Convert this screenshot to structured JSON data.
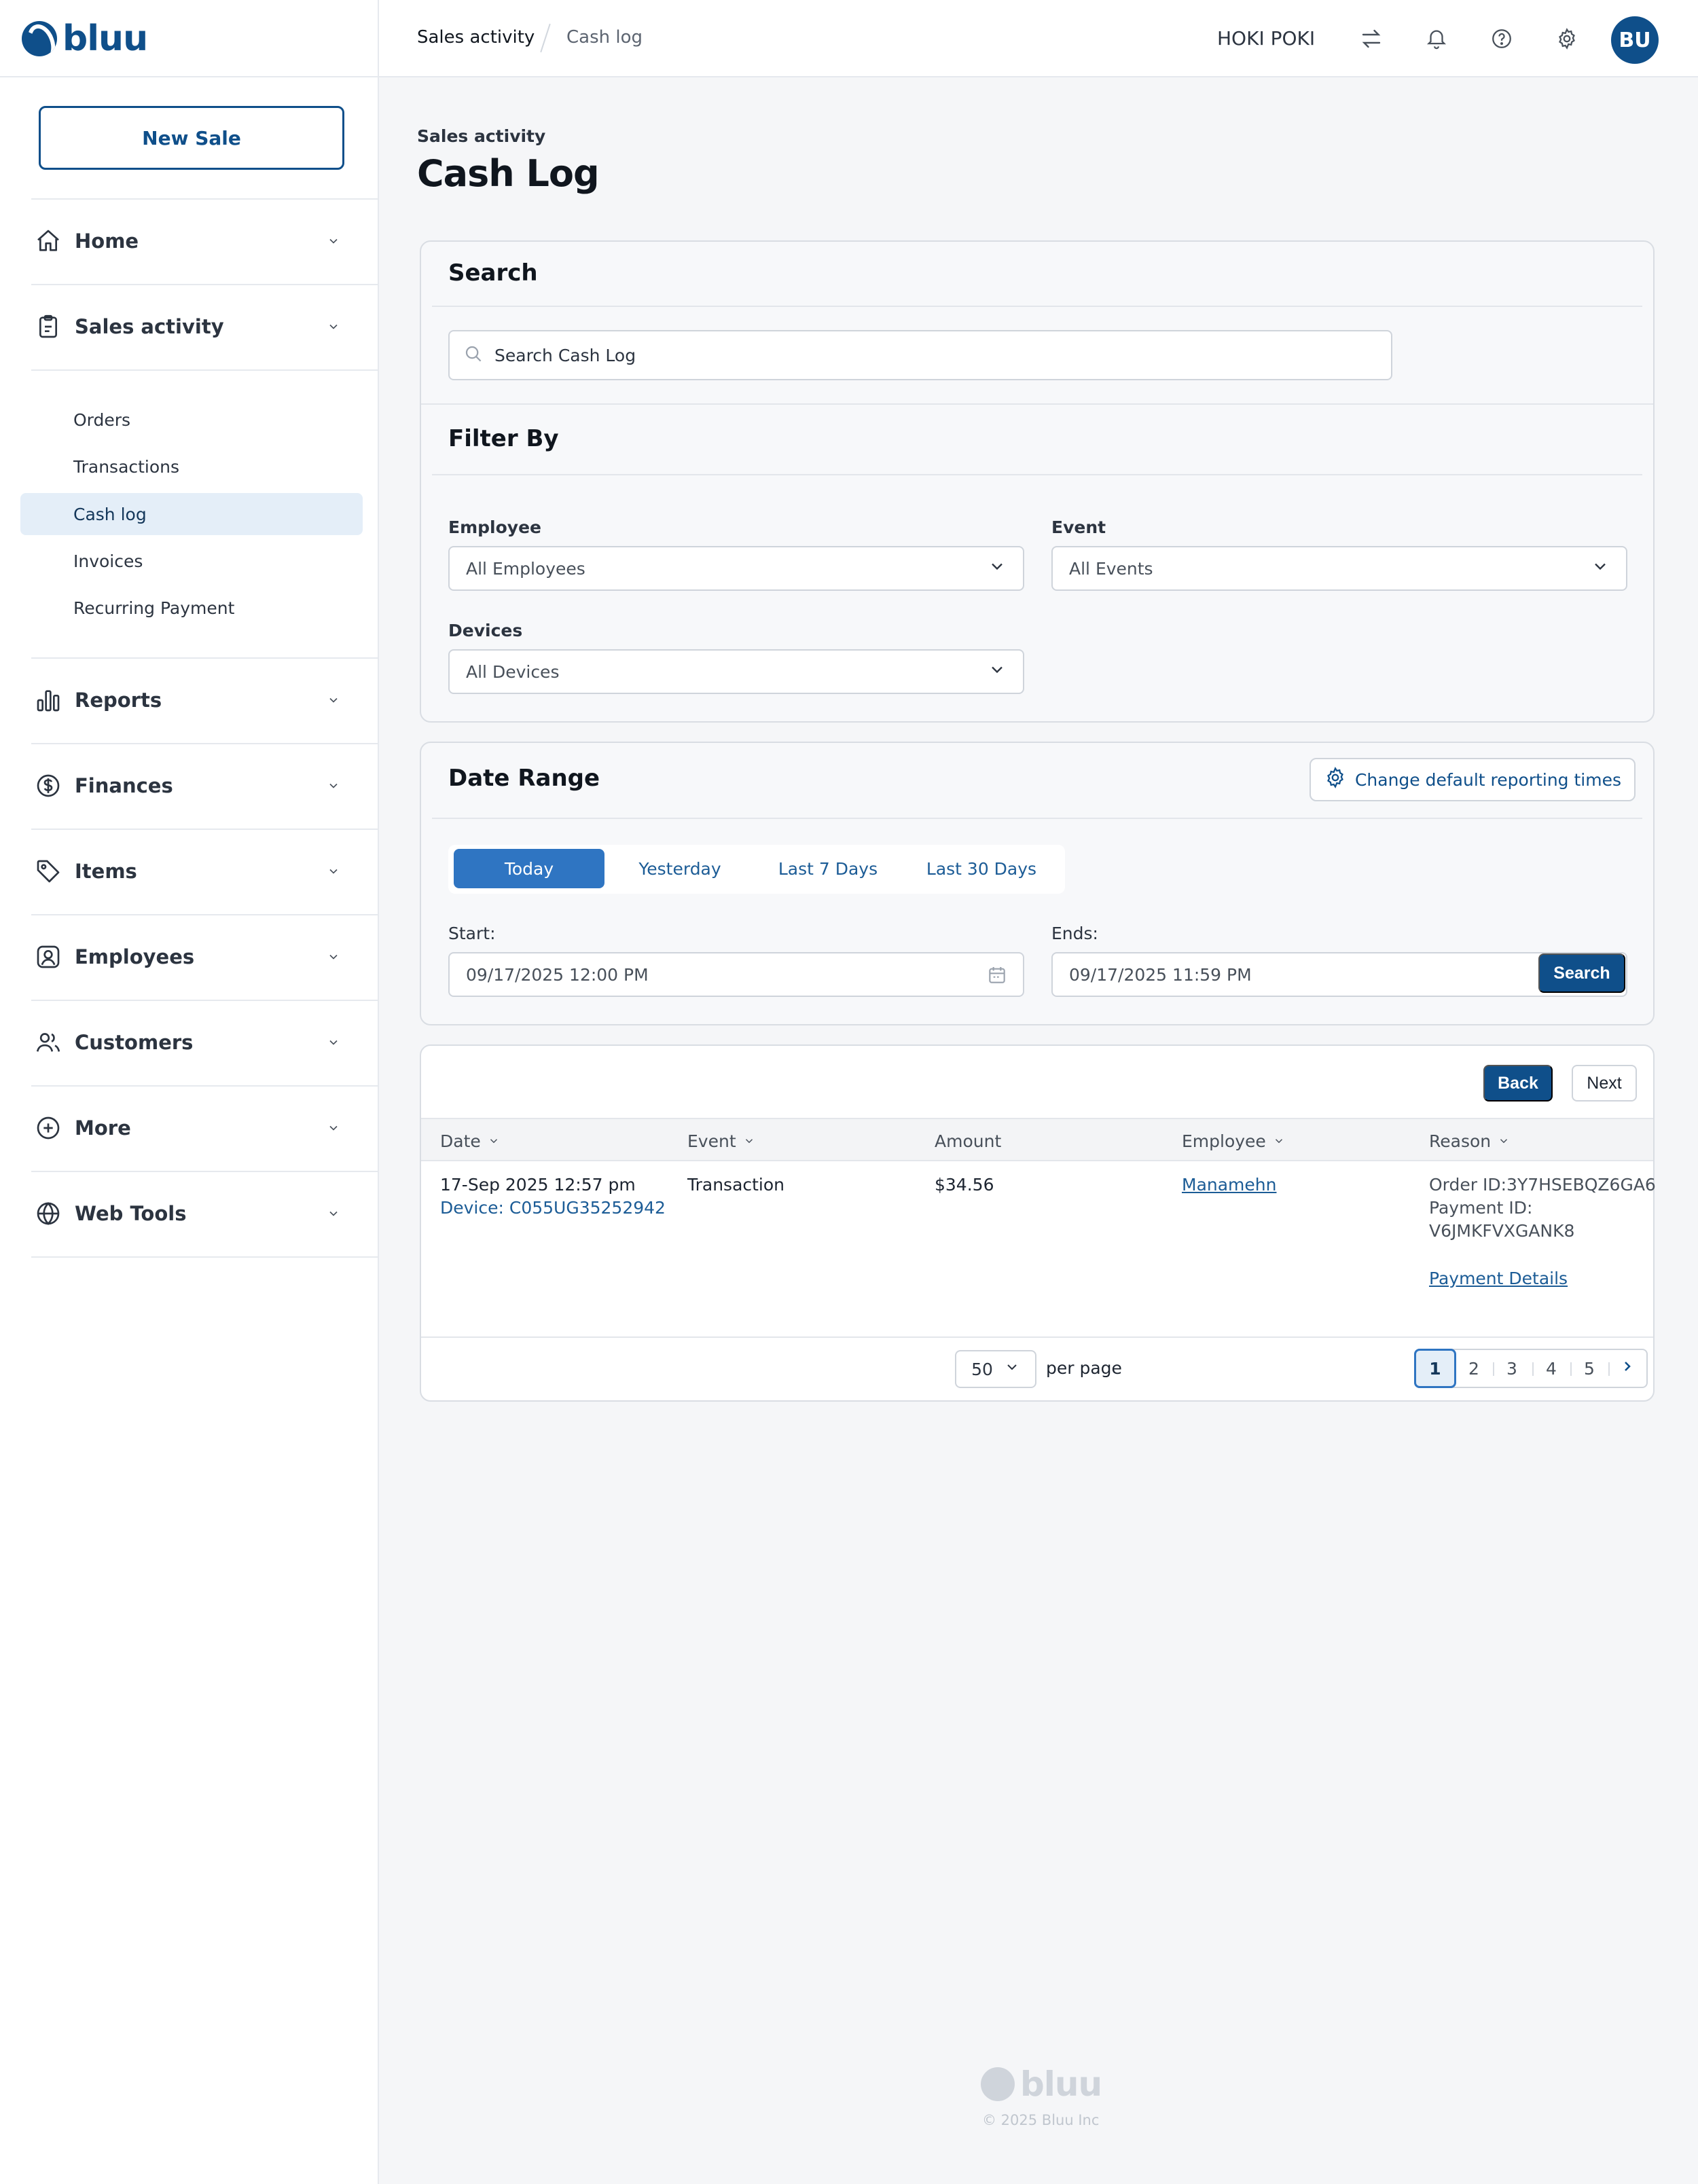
{
  "brand": {
    "name": "bluu",
    "color": "#0f4f8a"
  },
  "sidebar": {
    "new_sale_label": "New Sale",
    "nav": [
      {
        "label": "Home",
        "icon": "home-icon"
      },
      {
        "label": "Sales activity",
        "icon": "clipboard-icon"
      },
      {
        "label": "Reports",
        "icon": "bar-chart-icon"
      },
      {
        "label": "Finances",
        "icon": "dollar-circle-icon"
      },
      {
        "label": "Items",
        "icon": "tag-icon"
      },
      {
        "label": "Employees",
        "icon": "user-square-icon"
      },
      {
        "label": "Customers",
        "icon": "users-icon"
      },
      {
        "label": "More",
        "icon": "plus-circle-icon"
      },
      {
        "label": "Web Tools",
        "icon": "globe-icon"
      }
    ],
    "sales_sub": [
      {
        "label": "Orders"
      },
      {
        "label": "Transactions"
      },
      {
        "label": "Cash log",
        "active": true
      },
      {
        "label": "Invoices"
      },
      {
        "label": "Recurring Payment"
      }
    ]
  },
  "topbar": {
    "breadcrumb": [
      "Sales activity",
      "Cash log"
    ],
    "store_name": "HOKI POKI",
    "icons": [
      "swap-icon",
      "bell-icon",
      "help-icon",
      "gear-icon"
    ],
    "avatar_initials": "BU"
  },
  "page": {
    "eyebrow": "Sales activity",
    "title": "Cash Log"
  },
  "search": {
    "heading": "Search",
    "placeholder": "Search Cash Log"
  },
  "filters": {
    "heading": "Filter By",
    "employee": {
      "label": "Employee",
      "value": "All Employees"
    },
    "event": {
      "label": "Event",
      "value": "All Events"
    },
    "devices": {
      "label": "Devices",
      "value": "All Devices"
    }
  },
  "date_range": {
    "heading": "Date Range",
    "change_label": "Change default reporting times",
    "presets": [
      "Today",
      "Yesterday",
      "Last 7 Days",
      "Last 30 Days"
    ],
    "active_preset": "Today",
    "start_label": "Start:",
    "start_value": "09/17/2025 12:00 PM",
    "end_label": "Ends:",
    "end_value": "09/17/2025 11:59 PM",
    "search_label": "Search"
  },
  "results": {
    "back_label": "Back",
    "next_label": "Next",
    "columns": [
      "Date",
      "Event",
      "Amount",
      "Employee",
      "Reason"
    ],
    "rows": [
      {
        "date": "17-Sep 2025 12:57 pm",
        "device": "Device: C055UG35252942",
        "event": "Transaction",
        "amount": "$34.56",
        "employee": "Manamehn",
        "reason_order": "Order ID:3Y7HSEBQZ6GA6",
        "reason_payment_label": "Payment ID:",
        "reason_payment_id": "V6JMKFVXGANK8",
        "reason_link": "Payment Details"
      }
    ],
    "per_page_value": "50",
    "per_page_label": "per page",
    "pages": [
      "1",
      "2",
      "3",
      "4",
      "5"
    ],
    "current_page": "1"
  },
  "footer": {
    "brand": "bluu",
    "copyright": "© 2025 Bluu Inc"
  }
}
